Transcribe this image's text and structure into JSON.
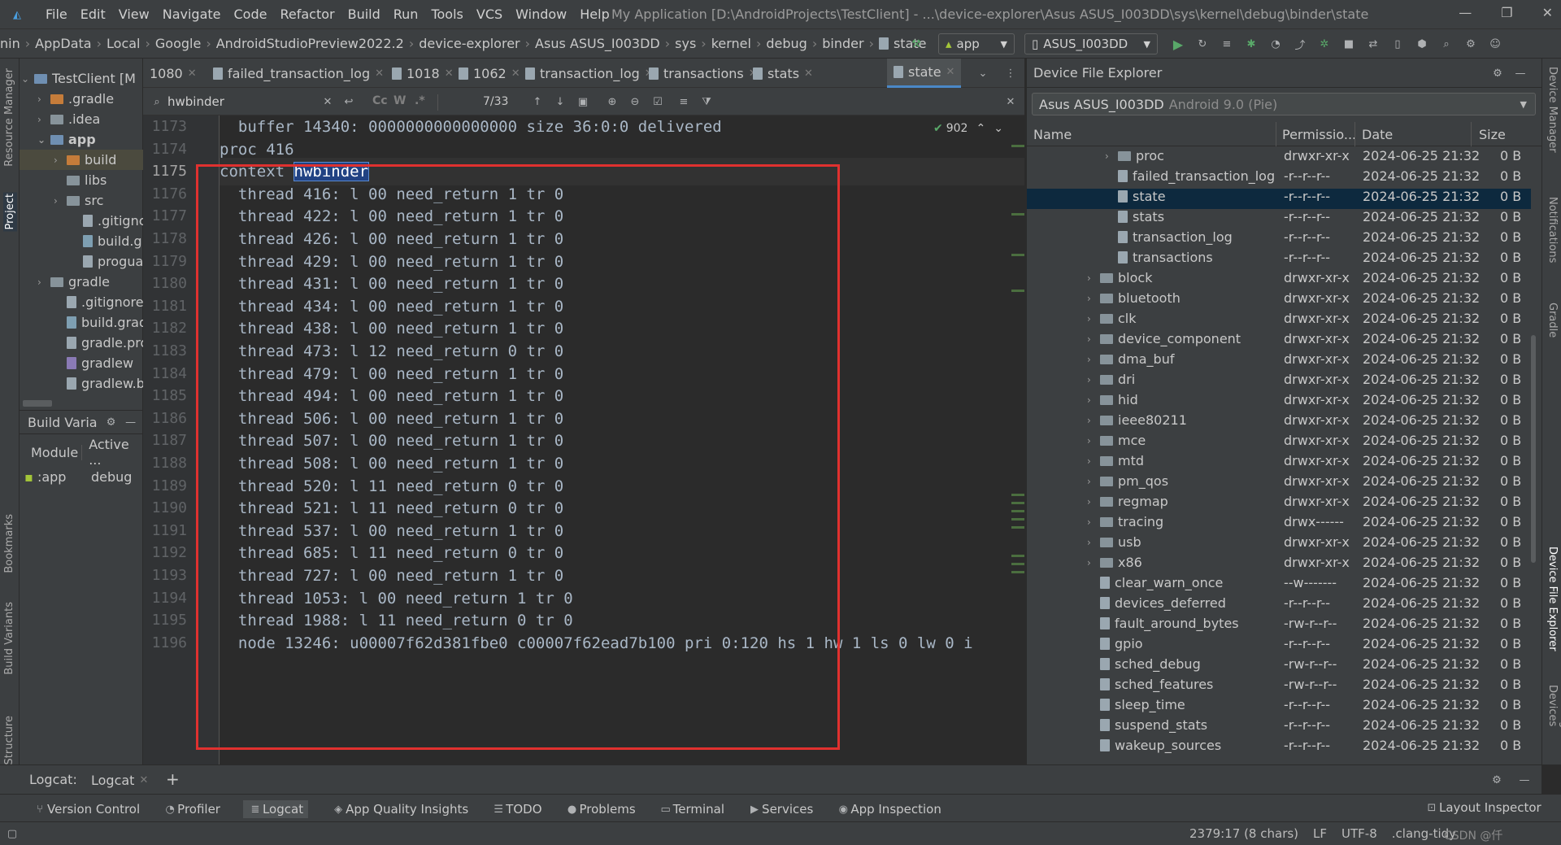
{
  "titlebar": {
    "menus": [
      "File",
      "Edit",
      "View",
      "Navigate",
      "Code",
      "Refactor",
      "Build",
      "Run",
      "Tools",
      "VCS",
      "Window",
      "Help"
    ],
    "title": "My Application [D:\\AndroidProjects\\TestClient] - ...\\device-explorer\\Asus ASUS_I003DD\\sys\\kernel\\debug\\binder\\state",
    "minimize": "—",
    "restore": "❐",
    "close": "✕"
  },
  "navbar": {
    "crumbs": [
      "nin",
      "AppData",
      "Local",
      "Google",
      "AndroidStudioPreview2022.2",
      "device-explorer",
      "Asus ASUS_I003DD",
      "sys",
      "kernel",
      "debug",
      "binder",
      "state"
    ],
    "run_config": "app",
    "device": "ASUS_I003DD"
  },
  "left_stripe": {
    "resource_manager": "Resource Manager",
    "project": "Project",
    "bookmarks": "Bookmarks",
    "build_variants": "Build Variants",
    "structure": "Structure"
  },
  "right_stripe": {
    "device_manager": "Device Manager",
    "notifications": "Notifications",
    "gradle": "Gradle",
    "device_file_explorer": "Device File Explorer",
    "running_devices": "Running Devices"
  },
  "project": {
    "root": "TestClient [M",
    "items": [
      ".gradle",
      ".idea",
      "app",
      "build",
      "libs",
      "src",
      ".gitignc",
      "build.g",
      "progua",
      "gradle",
      ".gitignore",
      "build.grad",
      "gradle.pro",
      "gradlew",
      "gradlew.ba"
    ],
    "build_variants_title": "Build Varia",
    "bv_col_module": "Module",
    "bv_col_active": "Active ...",
    "bv_module": ":app",
    "bv_variant": "debug"
  },
  "tabs": [
    "1080",
    "failed_transaction_log",
    "1018",
    "1062",
    "transaction_log",
    "transactions",
    "stats",
    "state"
  ],
  "search": {
    "query": "hwbinder",
    "match_case": "Cc",
    "words": "W",
    "regex": ".*",
    "count": "7/33"
  },
  "editor": {
    "line_numbers": [
      "1173",
      "1174",
      "1175",
      "1176",
      "1177",
      "1178",
      "1179",
      "1180",
      "1181",
      "1182",
      "1183",
      "1184",
      "1185",
      "1186",
      "1187",
      "1188",
      "1189",
      "1190",
      "1191",
      "1192",
      "1193",
      "1194",
      "1195",
      "1196"
    ],
    "current_line": "1175",
    "inspections_count": "902",
    "lines": [
      "  buffer 14340: 0000000000000000 size 36:0:0 delivered",
      "proc 416",
      "context ",
      "  thread 416: l 00 need_return 1 tr 0",
      "  thread 422: l 00 need_return 1 tr 0",
      "  thread 426: l 00 need_return 1 tr 0",
      "  thread 429: l 00 need_return 1 tr 0",
      "  thread 431: l 00 need_return 1 tr 0",
      "  thread 434: l 00 need_return 1 tr 0",
      "  thread 438: l 00 need_return 1 tr 0",
      "  thread 473: l 12 need_return 0 tr 0",
      "  thread 479: l 00 need_return 1 tr 0",
      "  thread 494: l 00 need_return 1 tr 0",
      "  thread 506: l 00 need_return 1 tr 0",
      "  thread 507: l 00 need_return 1 tr 0",
      "  thread 508: l 00 need_return 1 tr 0",
      "  thread 520: l 11 need_return 0 tr 0",
      "  thread 521: l 11 need_return 0 tr 0",
      "  thread 537: l 00 need_return 1 tr 0",
      "  thread 685: l 11 need_return 0 tr 0",
      "  thread 727: l 00 need_return 1 tr 0",
      "  thread 1053: l 00 need_return 1 tr 0",
      "  thread 1988: l 11 need_return 0 tr 0",
      "  node 13246: u00007f62d381fbe0 c00007f62ead7b100 pri 0:120 hs 1 hw 1 ls 0 lw 0 i"
    ],
    "highlighted_word": "hwbinder",
    "highlight_color": "#214283",
    "annotation_box_color": "#e0312f"
  },
  "dfe": {
    "title": "Device File Explorer",
    "device": "Asus ASUS_I003DD",
    "android": "Android 9.0 (Pie)",
    "col_name": "Name",
    "col_perm": "Permissio...",
    "col_date": "Date",
    "col_size": "Size",
    "rows": [
      {
        "name": "proc",
        "perm": "drwxr-xr-x",
        "date": "2024-06-25 21:32",
        "size": "0 B",
        "type": "folder",
        "depth": 1,
        "expandable": true
      },
      {
        "name": "failed_transaction_log",
        "perm": "-r--r--r--",
        "date": "2024-06-25 21:32",
        "size": "0 B",
        "type": "file",
        "depth": 1
      },
      {
        "name": "state",
        "perm": "-r--r--r--",
        "date": "2024-06-25 21:32",
        "size": "0 B",
        "type": "file",
        "depth": 1,
        "selected": true
      },
      {
        "name": "stats",
        "perm": "-r--r--r--",
        "date": "2024-06-25 21:32",
        "size": "0 B",
        "type": "file",
        "depth": 1
      },
      {
        "name": "transaction_log",
        "perm": "-r--r--r--",
        "date": "2024-06-25 21:32",
        "size": "0 B",
        "type": "file",
        "depth": 1
      },
      {
        "name": "transactions",
        "perm": "-r--r--r--",
        "date": "2024-06-25 21:32",
        "size": "0 B",
        "type": "file",
        "depth": 1
      },
      {
        "name": "block",
        "perm": "drwxr-xr-x",
        "date": "2024-06-25 21:32",
        "size": "0 B",
        "type": "folder",
        "depth": 0,
        "expandable": true
      },
      {
        "name": "bluetooth",
        "perm": "drwxr-xr-x",
        "date": "2024-06-25 21:32",
        "size": "0 B",
        "type": "folder",
        "depth": 0,
        "expandable": true
      },
      {
        "name": "clk",
        "perm": "drwxr-xr-x",
        "date": "2024-06-25 21:32",
        "size": "0 B",
        "type": "folder",
        "depth": 0,
        "expandable": true
      },
      {
        "name": "device_component",
        "perm": "drwxr-xr-x",
        "date": "2024-06-25 21:32",
        "size": "0 B",
        "type": "folder",
        "depth": 0,
        "expandable": true
      },
      {
        "name": "dma_buf",
        "perm": "drwxr-xr-x",
        "date": "2024-06-25 21:32",
        "size": "0 B",
        "type": "folder",
        "depth": 0,
        "expandable": true
      },
      {
        "name": "dri",
        "perm": "drwxr-xr-x",
        "date": "2024-06-25 21:32",
        "size": "0 B",
        "type": "folder",
        "depth": 0,
        "expandable": true
      },
      {
        "name": "hid",
        "perm": "drwxr-xr-x",
        "date": "2024-06-25 21:32",
        "size": "0 B",
        "type": "folder",
        "depth": 0,
        "expandable": true
      },
      {
        "name": "ieee80211",
        "perm": "drwxr-xr-x",
        "date": "2024-06-25 21:32",
        "size": "0 B",
        "type": "folder",
        "depth": 0,
        "expandable": true
      },
      {
        "name": "mce",
        "perm": "drwxr-xr-x",
        "date": "2024-06-25 21:32",
        "size": "0 B",
        "type": "folder",
        "depth": 0,
        "expandable": true
      },
      {
        "name": "mtd",
        "perm": "drwxr-xr-x",
        "date": "2024-06-25 21:32",
        "size": "0 B",
        "type": "folder",
        "depth": 0,
        "expandable": true
      },
      {
        "name": "pm_qos",
        "perm": "drwxr-xr-x",
        "date": "2024-06-25 21:32",
        "size": "0 B",
        "type": "folder",
        "depth": 0,
        "expandable": true
      },
      {
        "name": "regmap",
        "perm": "drwxr-xr-x",
        "date": "2024-06-25 21:32",
        "size": "0 B",
        "type": "folder",
        "depth": 0,
        "expandable": true
      },
      {
        "name": "tracing",
        "perm": "drwx------",
        "date": "2024-06-25 21:32",
        "size": "0 B",
        "type": "folder",
        "depth": 0,
        "expandable": true
      },
      {
        "name": "usb",
        "perm": "drwxr-xr-x",
        "date": "2024-06-25 21:32",
        "size": "0 B",
        "type": "folder",
        "depth": 0,
        "expandable": true
      },
      {
        "name": "x86",
        "perm": "drwxr-xr-x",
        "date": "2024-06-25 21:32",
        "size": "0 B",
        "type": "folder",
        "depth": 0,
        "expandable": true
      },
      {
        "name": "clear_warn_once",
        "perm": "--w-------",
        "date": "2024-06-25 21:32",
        "size": "0 B",
        "type": "file",
        "depth": 0
      },
      {
        "name": "devices_deferred",
        "perm": "-r--r--r--",
        "date": "2024-06-25 21:32",
        "size": "0 B",
        "type": "file",
        "depth": 0
      },
      {
        "name": "fault_around_bytes",
        "perm": "-rw-r--r--",
        "date": "2024-06-25 21:32",
        "size": "0 B",
        "type": "file",
        "depth": 0
      },
      {
        "name": "gpio",
        "perm": "-r--r--r--",
        "date": "2024-06-25 21:32",
        "size": "0 B",
        "type": "file",
        "depth": 0
      },
      {
        "name": "sched_debug",
        "perm": "-rw-r--r--",
        "date": "2024-06-25 21:32",
        "size": "0 B",
        "type": "file",
        "depth": 0
      },
      {
        "name": "sched_features",
        "perm": "-rw-r--r--",
        "date": "2024-06-25 21:32",
        "size": "0 B",
        "type": "file",
        "depth": 0
      },
      {
        "name": "sleep_time",
        "perm": "-r--r--r--",
        "date": "2024-06-25 21:32",
        "size": "0 B",
        "type": "file",
        "depth": 0
      },
      {
        "name": "suspend_stats",
        "perm": "-r--r--r--",
        "date": "2024-06-25 21:32",
        "size": "0 B",
        "type": "file",
        "depth": 0
      },
      {
        "name": "wakeup_sources",
        "perm": "-r--r--r--",
        "date": "2024-06-25 21:32",
        "size": "0 B",
        "type": "file",
        "depth": 0
      }
    ]
  },
  "logcat": {
    "label": "Logcat:",
    "tab": "Logcat"
  },
  "bottom_tools": [
    "Version Control",
    "Profiler",
    "Logcat",
    "App Quality Insights",
    "TODO",
    "Problems",
    "Terminal",
    "Services",
    "App Inspection"
  ],
  "layout_inspector": "Layout Inspector",
  "status": {
    "position": "2379:17 (8 chars)",
    "line_sep": "LF",
    "encoding": "UTF-8",
    "formatter": ".clang-tidy",
    "watermark": "CSDN @仟"
  }
}
